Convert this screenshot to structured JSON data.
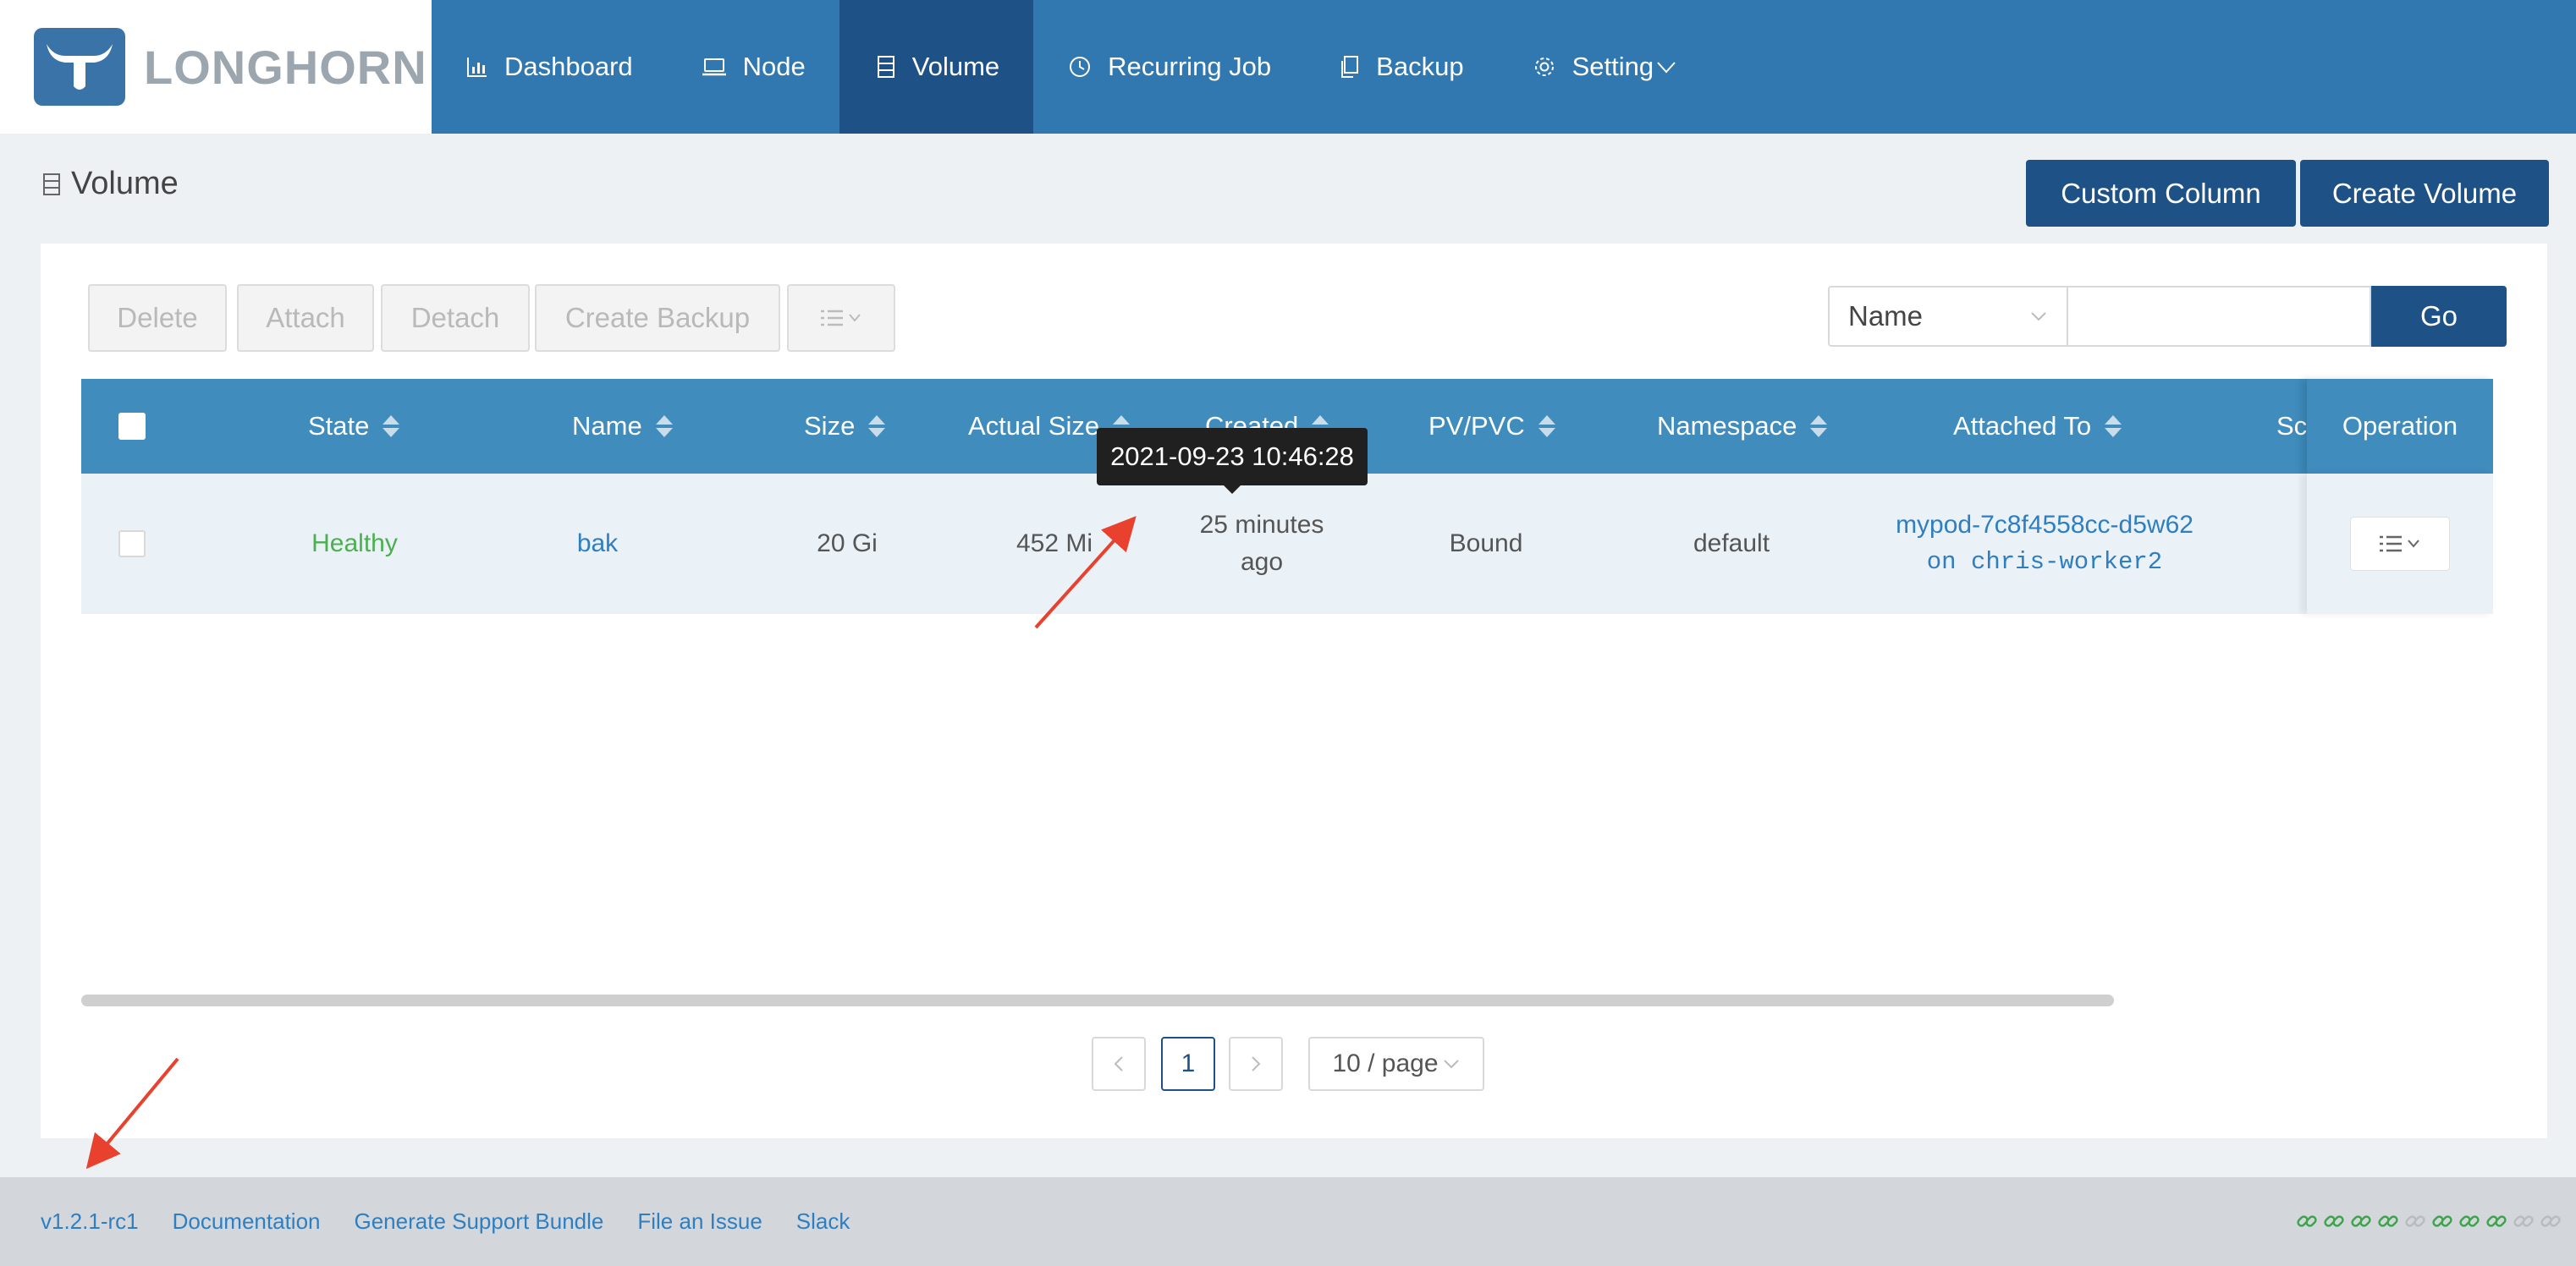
{
  "app": {
    "logo_text": "LONGHORN",
    "nav": [
      {
        "label": "Dashboard",
        "icon": "bar-chart-icon"
      },
      {
        "label": "Node",
        "icon": "laptop-icon"
      },
      {
        "label": "Volume",
        "icon": "volume-icon",
        "active": true
      },
      {
        "label": "Recurring Job",
        "icon": "clock-icon"
      },
      {
        "label": "Backup",
        "icon": "copy-icon"
      },
      {
        "label": "Setting",
        "icon": "gear-icon"
      }
    ]
  },
  "page": {
    "title": "Volume",
    "custom_column_label": "Custom Column",
    "create_volume_label": "Create Volume"
  },
  "actions": {
    "delete": "Delete",
    "attach": "Attach",
    "detach": "Detach",
    "create_backup": "Create Backup"
  },
  "search": {
    "field": "Name",
    "value": "",
    "go_label": "Go"
  },
  "table": {
    "columns": [
      "State",
      "Name",
      "Size",
      "Actual Size",
      "Created",
      "PV/PVC",
      "Namespace",
      "Attached To",
      "Sc",
      "Operation"
    ],
    "rows": [
      {
        "state": "Healthy",
        "name": "bak",
        "size": "20 Gi",
        "actual_size": "452 Mi",
        "created_line1": "25 minutes",
        "created_line2": "ago",
        "pvpvc": "Bound",
        "namespace": "default",
        "attached_line1": "mypod-7c8f4558cc-d5w62",
        "attached_line2": "on chris-worker2"
      }
    ],
    "tooltip": "2021-09-23 10:46:28"
  },
  "pagination": {
    "current_page": "1",
    "page_size": "10 / page"
  },
  "footer": {
    "version": "v1.2.1-rc1",
    "links": [
      "Documentation",
      "Generate Support Bundle",
      "File an Issue",
      "Slack"
    ],
    "connection_status": [
      "on",
      "on",
      "on",
      "on",
      "off",
      "on",
      "on",
      "on",
      "off",
      "off"
    ]
  },
  "colors": {
    "nav_bg": "#3178b0",
    "nav_active": "#1e5286",
    "table_header": "#3f8cbd",
    "healthy": "#4caf50",
    "link": "#2e7fc2",
    "annotation_arrow": "#e8412e"
  }
}
